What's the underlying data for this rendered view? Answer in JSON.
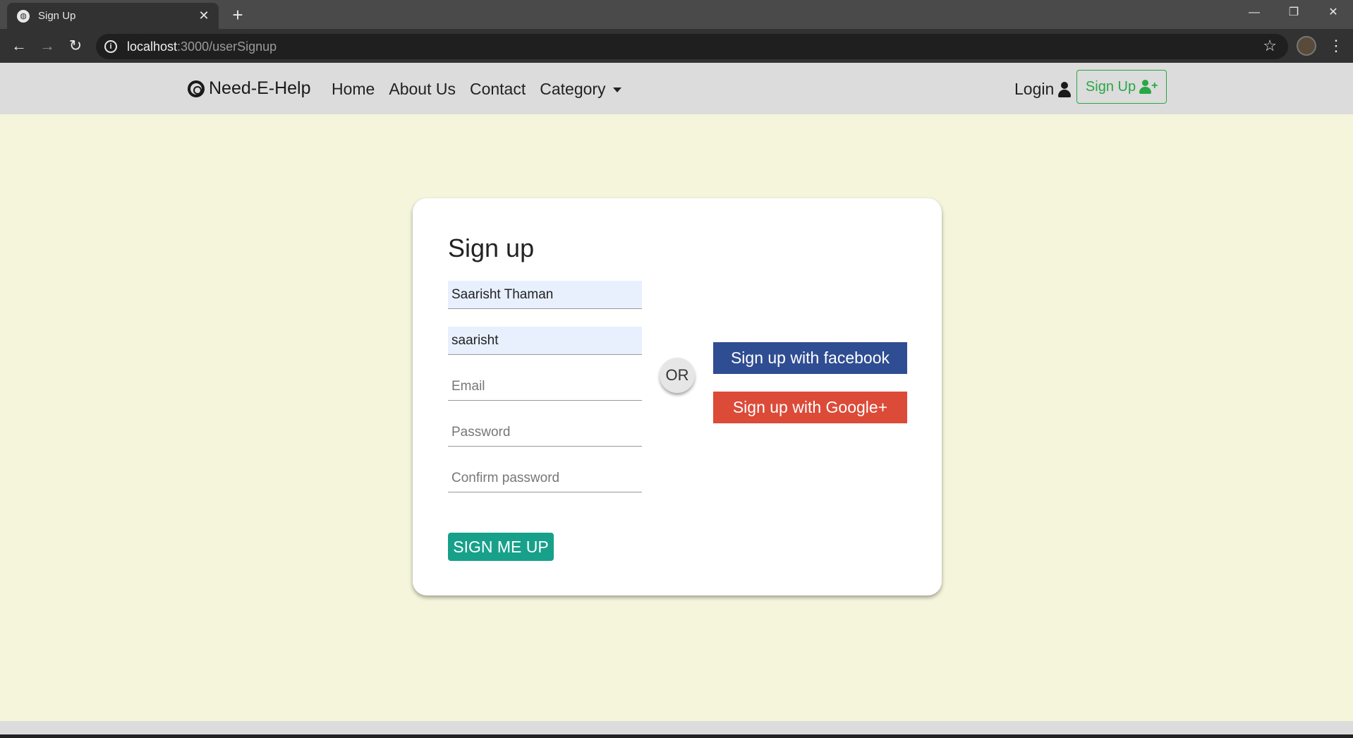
{
  "browser": {
    "tab_title": "Sign Up",
    "tab_close": "✕",
    "new_tab": "+",
    "url_host": "localhost",
    "url_path": ":3000/userSignup",
    "window_controls": {
      "minimize": "—",
      "restore": "❐",
      "close": "✕"
    },
    "back": "←",
    "forward": "→",
    "reload": "↻",
    "star": "☆",
    "menu": "⋮"
  },
  "navbar": {
    "brand": "Need-E-Help",
    "links": [
      "Home",
      "About Us",
      "Contact",
      "Category"
    ],
    "login": "Login",
    "signup": "Sign Up"
  },
  "form": {
    "title": "Sign up",
    "name_value": "Saarisht Thaman",
    "username_value": "saarisht",
    "email_placeholder": "Email",
    "password_placeholder": "Password",
    "confirm_placeholder": "Confirm password",
    "submit": "SIGN ME UP",
    "or": "OR",
    "facebook": "Sign up with facebook",
    "google": "Sign up with Google+"
  },
  "colors": {
    "page_bg": "#f5f5dc",
    "navbar_bg": "#dcdcdc",
    "facebook": "#2f4d92",
    "google": "#dc4a38",
    "submit": "#17a08a",
    "signup_green": "#28a745"
  }
}
